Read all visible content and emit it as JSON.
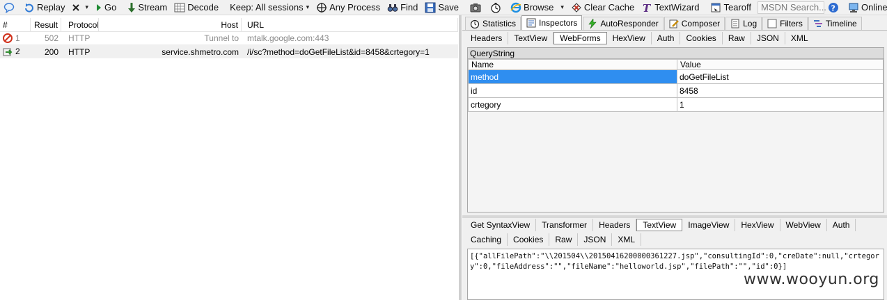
{
  "toolbar": {
    "replay": "Replay",
    "go": "Go",
    "stream": "Stream",
    "decode": "Decode",
    "keep": "Keep: All sessions",
    "any_process": "Any Process",
    "find": "Find",
    "save": "Save",
    "browse": "Browse",
    "clear_cache": "Clear Cache",
    "textwizard": "TextWizard",
    "tearoff": "Tearoff",
    "msdn_placeholder": "MSDN Search...",
    "online": "Online",
    "close": "x"
  },
  "sessions": {
    "headers": [
      "#",
      "Result",
      "Protocol",
      "Host",
      "URL"
    ],
    "rows": [
      {
        "num": "1",
        "result": "502",
        "protocol": "HTTP",
        "host": "Tunnel to",
        "url": "mtalk.google.com:443"
      },
      {
        "num": "2",
        "result": "200",
        "protocol": "HTTP",
        "host": "service.shmetro.com",
        "url": "/i/sc?method=doGetFileList&id=8458&crtegory=1"
      }
    ]
  },
  "main_tabs": [
    "Statistics",
    "Inspectors",
    "AutoResponder",
    "Composer",
    "Log",
    "Filters",
    "Timeline"
  ],
  "request_tabs": [
    "Headers",
    "TextView",
    "WebForms",
    "HexView",
    "Auth",
    "Cookies",
    "Raw",
    "JSON",
    "XML"
  ],
  "querystring": {
    "title": "QueryString",
    "col_name": "Name",
    "col_value": "Value",
    "rows": [
      {
        "name": "method",
        "value": "doGetFileList"
      },
      {
        "name": "id",
        "value": "8458"
      },
      {
        "name": "crtegory",
        "value": "1"
      }
    ]
  },
  "response_tabs_row1": [
    "Get SyntaxView",
    "Transformer",
    "Headers",
    "TextView",
    "ImageView",
    "HexView",
    "WebView",
    "Auth"
  ],
  "response_tabs_row2": [
    "Caching",
    "Cookies",
    "Raw",
    "JSON",
    "XML"
  ],
  "response_body": "[{\"allFilePath\":\"\\\\201504\\\\20150416200000361227.jsp\",\"consultingId\":0,\"creDate\":null,\"crtegory\":0,\"fileAddress\":\"\",\"fileName\":\"helloworld.jsp\",\"filePath\":\"\",\"id\":0}]",
  "watermark": "www.wooyun.org"
}
